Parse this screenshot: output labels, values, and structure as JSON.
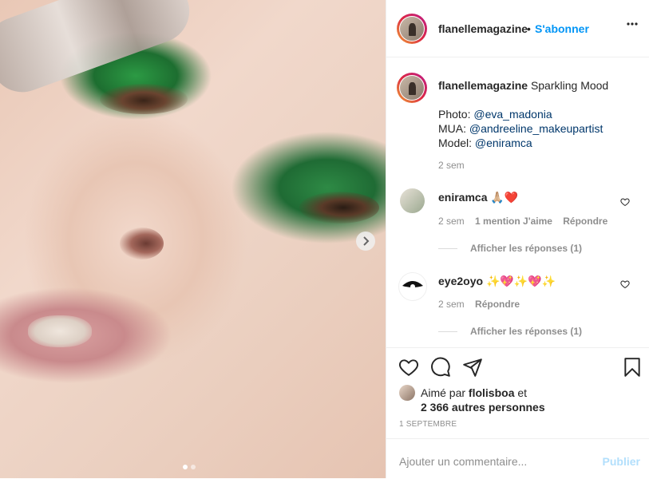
{
  "header": {
    "username": "flanellemagazine",
    "separator": "•",
    "follow_label": "S'abonner",
    "more_icon": "more-horizontal-icon"
  },
  "caption": {
    "username": "flanellemagazine",
    "text": "Sparkling Mood",
    "photo_prefix": "Photo: ",
    "photo_mention": "@eva_madonia",
    "mua_prefix": "MUA: ",
    "mua_mention": "@andreeline_makeupartist",
    "model_prefix": "Model: ",
    "model_mention": "@eniramca",
    "time": "2 sem"
  },
  "comments": [
    {
      "username": "eniramca",
      "text": "🙏🏼❤️",
      "time": "2 sem",
      "likes": "1 mention J'aime",
      "reply": "Répondre",
      "view_replies": "Afficher les réponses (1)"
    },
    {
      "username": "eye2oyo",
      "text": "✨💖✨💖✨",
      "time": "2 sem",
      "reply": "Répondre",
      "view_replies": "Afficher les réponses (1)"
    }
  ],
  "likes": {
    "prefix": "Aimé par ",
    "user": "flolisboa",
    "mid": " et",
    "count": "2 366 autres personnes"
  },
  "date": "1 SEPTEMBRE",
  "add_comment": {
    "placeholder": "Ajouter un commentaire...",
    "publish": "Publier"
  },
  "carousel": {
    "total": 2,
    "current": 1
  },
  "colors": {
    "accent": "#0095f6",
    "publish_disabled": "#b2dffc",
    "mention": "#00376b",
    "muted": "#8e8e8e"
  }
}
